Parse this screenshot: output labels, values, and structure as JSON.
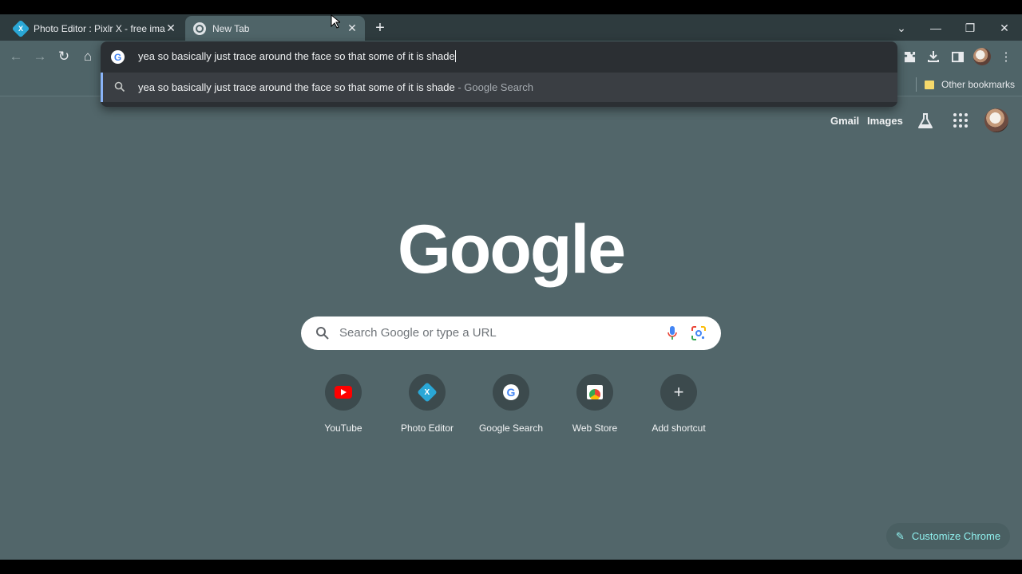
{
  "tabs": [
    {
      "title": "Photo Editor : Pixlr X - free image",
      "favicon": "pixlr-icon",
      "active": false
    },
    {
      "title": "New Tab",
      "favicon": "chrome-icon",
      "active": true
    }
  ],
  "window_controls": {
    "minimize": "—",
    "restore": "❐",
    "close": "✕",
    "tab_search": "⌄"
  },
  "toolbar": {
    "back": "←",
    "forward": "→",
    "reload": "↻",
    "home": "⌂"
  },
  "omnibox": {
    "query": "yea so basically just trace around the face so that some of it is shade",
    "suggestion_text": "yea so basically just trace around the face so that some of it is shade",
    "suggestion_source": " - Google Search"
  },
  "bookmarks": {
    "other_label": "Other bookmarks"
  },
  "ntp": {
    "gmail": "Gmail",
    "images": "Images",
    "logo": "Google",
    "search_placeholder": "Search Google or type a URL",
    "shortcuts": [
      {
        "label": "YouTube",
        "icon": "youtube-icon"
      },
      {
        "label": "Photo Editor",
        "icon": "pixlr-icon"
      },
      {
        "label": "Google Search",
        "icon": "google-icon"
      },
      {
        "label": "Web Store",
        "icon": "web-store-icon"
      },
      {
        "label": "Add shortcut",
        "icon": "plus-icon"
      }
    ],
    "customize_label": "Customize Chrome"
  },
  "colors": {
    "page_background": "#52666a",
    "tabstrip": "#2e3b3e",
    "omnibox_dropdown": "#2b2f33",
    "accent": "#8ff0ee"
  }
}
